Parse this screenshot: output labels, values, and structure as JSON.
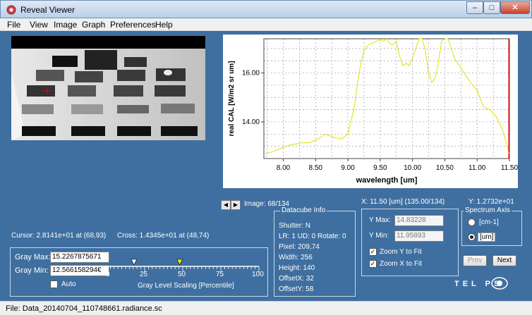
{
  "window": {
    "title": "Reveal Viewer"
  },
  "menu": [
    "File",
    "View",
    "Image",
    "Graph",
    "Preferences",
    "Help"
  ],
  "image_nav": {
    "label": "Image: 68/134"
  },
  "readouts": {
    "cursor": "Cursor: 2.8141e+01 at (68,93)",
    "cross": "Cross: 1.4345e+01 at (48,74)",
    "x_readout": "X: 11.50 [um]  (135.00/134)",
    "y_readout": "Y: 1.2732e+01"
  },
  "datacube": {
    "title": "Datacube Info",
    "lines": [
      "Shutter: N",
      "LR: 1 UD: 0 Rotate: 0",
      "Pixel: 209,74",
      "Width: 256",
      "Height: 140",
      "OffsetX: 32",
      "OffsetY: 58"
    ]
  },
  "gray": {
    "max_label": "Gray Max:",
    "max_value": "15.2267875671",
    "min_label": "Gray Min:",
    "min_value": "12.566158294€",
    "auto_label": "Auto",
    "scale_caption": "Gray Level Scaling [Percentile]",
    "ticks": [
      "0",
      "25",
      "50",
      "75",
      "100"
    ],
    "marker_low": 18,
    "marker_high": 48
  },
  "zoom": {
    "ymax_label": "Y Max:",
    "ymax_value": "14.83228",
    "ymin_label": "Y Min:",
    "ymin_value": "11.95893",
    "zoom_y_label": "Zoom Y to Fit",
    "zoom_x_label": "Zoom X to Fit"
  },
  "spectrum_axis": {
    "title": "Spectrum Axis",
    "option_cm": "[cm-1]",
    "option_um": "[um]"
  },
  "buttons": {
    "prev": "Prev",
    "next": "Next"
  },
  "logo": "TEL   PS",
  "status": "File: Data_20140704_110748661.radiance.sc",
  "colors": {
    "panel": "#3f6fa0",
    "spectrum": "#e0e000",
    "cursor_line": "#ff0000"
  },
  "chart_data": {
    "type": "line",
    "xlabel": "wavelength [um]",
    "ylabel": "real CAL [W/m2 sr um]",
    "xlim": [
      7.7,
      11.5
    ],
    "ylim": [
      12.5,
      17.4
    ],
    "xticks": [
      "8.00",
      "8.50",
      "9.00",
      "9.50",
      "10.00",
      "10.50",
      "11.00",
      "11.50"
    ],
    "yticks": [
      "14.00",
      "16.00"
    ],
    "grid": true,
    "x": [
      7.72,
      7.8,
      7.9,
      8.0,
      8.1,
      8.2,
      8.3,
      8.4,
      8.5,
      8.6,
      8.65,
      8.7,
      8.8,
      8.9,
      9.0,
      9.1,
      9.15,
      9.2,
      9.25,
      9.3,
      9.35,
      9.4,
      9.45,
      9.5,
      9.55,
      9.6,
      9.65,
      9.7,
      9.75,
      9.8,
      9.85,
      9.9,
      9.95,
      10.0,
      10.05,
      10.1,
      10.15,
      10.2,
      10.25,
      10.3,
      10.35,
      10.4,
      10.45,
      10.5,
      10.55,
      10.6,
      10.65,
      10.7,
      10.8,
      10.9,
      11.0,
      11.1,
      11.2,
      11.3,
      11.4,
      11.5
    ],
    "y": [
      12.7,
      12.75,
      12.85,
      12.95,
      13.05,
      13.1,
      13.15,
      13.15,
      13.25,
      13.4,
      13.5,
      13.45,
      13.35,
      13.3,
      13.5,
      14.6,
      15.6,
      16.4,
      16.9,
      17.1,
      17.2,
      17.25,
      17.3,
      17.35,
      17.3,
      17.4,
      17.2,
      17.15,
      17.3,
      16.7,
      16.3,
      16.4,
      16.3,
      16.6,
      17.0,
      17.5,
      17.4,
      16.9,
      16.0,
      15.6,
      15.8,
      16.4,
      17.3,
      17.6,
      17.4,
      17.0,
      16.6,
      16.4,
      16.0,
      15.6,
      15.3,
      14.6,
      14.5,
      14.2,
      13.6,
      12.7
    ]
  }
}
